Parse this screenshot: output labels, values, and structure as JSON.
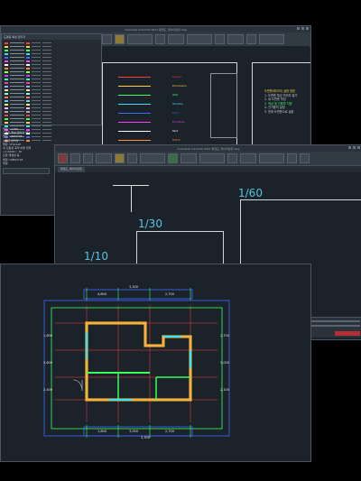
{
  "windows": [
    {
      "title": "Autodesk AutoCAD 2021  평면도_레이어설정.dwg"
    },
    {
      "title": "Autodesk AutoCAD 2021  평면도_레이어설정.dwg"
    }
  ],
  "file_tab": "평면도_레이어설정",
  "layer_panel": {
    "header": "도면층 특성 관리자",
    "colors": [
      "#ff3b3b",
      "#ffd23b",
      "#3bff5a",
      "#3be0ff",
      "#3b6bff",
      "#ff3bf0",
      "#ffffff",
      "#ff8a3b",
      "#a0ff3b",
      "#c03bff",
      "#3bffb8",
      "#ff3b9a",
      "#9ab0ff",
      "#ffe08a",
      "#8affd0",
      "#ff6b6b",
      "#6bd0ff",
      "#d0ff6b",
      "#ffb0ff",
      "#b0b0b0",
      "#ff3b3b",
      "#3bff5a",
      "#ffd23b",
      "#3be0ff",
      "#ff3bf0",
      "#ffffff",
      "#3b6bff",
      "#ff8a3b"
    ]
  },
  "layer_legend": [
    {
      "name": "Center",
      "color": "#ff3b3b"
    },
    {
      "name": "Dimension",
      "color": "#ffd23b"
    },
    {
      "name": "Wall",
      "color": "#3bff5a"
    },
    {
      "name": "Window",
      "color": "#3be0ff"
    },
    {
      "name": "Door",
      "color": "#3b6bff"
    },
    {
      "name": "Furniture",
      "color": "#ff3bf0"
    },
    {
      "name": "Text",
      "color": "#ffffff"
    },
    {
      "name": "Hatch",
      "color": "#ff8a3b"
    },
    {
      "name": "Column",
      "color": "#a0ff3b"
    },
    {
      "name": "Stair",
      "color": "#c03bff"
    },
    {
      "name": "Finish",
      "color": "#3bffb8"
    }
  ],
  "notes_panel": {
    "heading": "도면층(레이어) 설정 방법",
    "lines": [
      "1. 도면층 특성 관리자 열기",
      "2. 새 도면층 작성",
      "3. 색상 및 선종류 지정",
      "4. 선가중치 설정",
      "5. 현재 도면층으로 설정"
    ]
  },
  "command_history": {
    "lines": [
      "명령: LAYER",
      "도면층 특성 관리자 열기",
      "명령: LINETYPE",
      "선종류 관리자",
      "명령: LTSCALE",
      "새 선종류 축척 비율 입력",
      "<1.0000>: 10",
      "모형 재생성 중.",
      "명령: DIMSTYLE",
      "명령:"
    ]
  },
  "scales": [
    "1/60",
    "1/30",
    "1/10"
  ],
  "floor_plan": {
    "dims_top": [
      "4,800",
      "3,300",
      "2,700"
    ],
    "dims_bottom": [
      "1,800",
      "3,000",
      "2,700",
      "3,300"
    ],
    "dims_left": [
      "1,800",
      "3,600",
      "2,400"
    ],
    "dims_right": [
      "2,700",
      "3,000",
      "2,100"
    ]
  }
}
